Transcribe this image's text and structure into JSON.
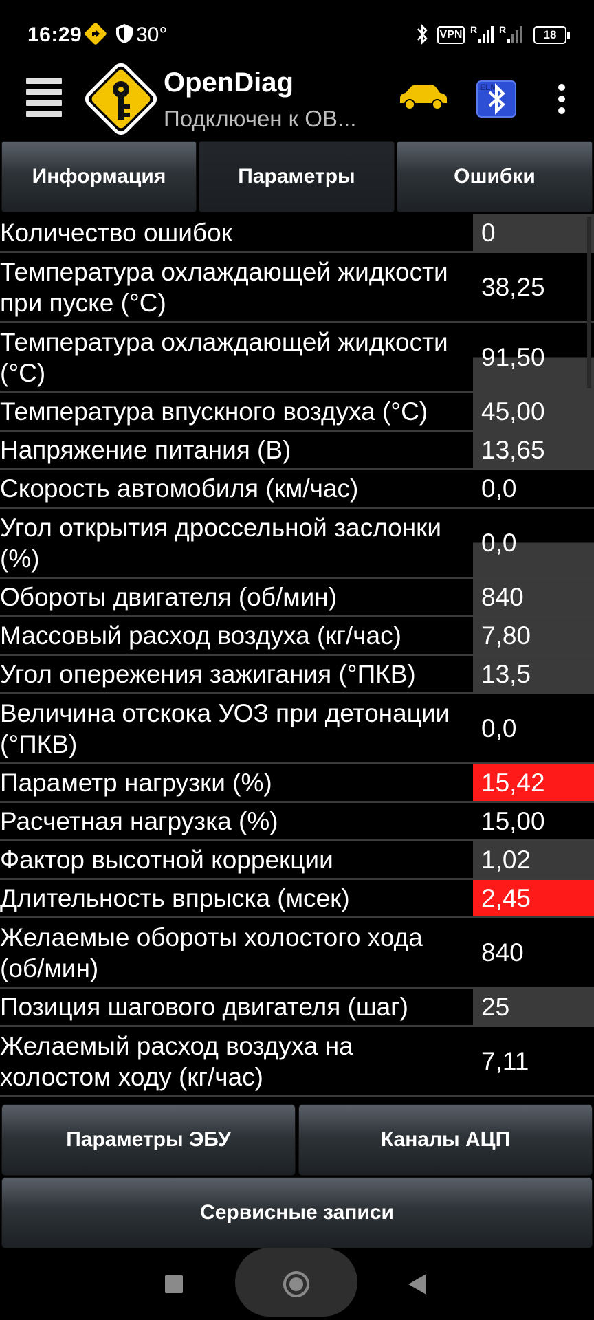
{
  "status_bar": {
    "time": "16:29",
    "temperature": "30°",
    "vpn_label": "VPN",
    "battery": "18"
  },
  "app": {
    "title": "OpenDiag",
    "subtitle": "Подключен к ОВ..."
  },
  "tabs": [
    {
      "label": "Информация",
      "active": false
    },
    {
      "label": "Параметры",
      "active": true
    },
    {
      "label": "Ошибки",
      "active": false
    }
  ],
  "parameters": [
    {
      "name": "Количество ошибок",
      "value": "0",
      "highlight": "grey"
    },
    {
      "name": "Температура охлаждающей жидкости при пуске (°C)",
      "value": "38,25",
      "highlight": "none"
    },
    {
      "name": "Температура охлаждающей жидкости (°C)",
      "value": "91,50",
      "highlight": "half"
    },
    {
      "name": "Температура впускного воздуха (°C)",
      "value": "45,00",
      "highlight": "grey"
    },
    {
      "name": "Напряжение питания (В)",
      "value": "13,65",
      "highlight": "grey"
    },
    {
      "name": "Скорость автомобиля (км/час)",
      "value": "0,0",
      "highlight": "none"
    },
    {
      "name": "Угол открытия дроссельной заслонки (%)",
      "value": "0,0",
      "highlight": "half"
    },
    {
      "name": "Обороты двигателя (об/мин)",
      "value": "840",
      "highlight": "grey"
    },
    {
      "name": "Массовый расход воздуха (кг/час)",
      "value": "7,80",
      "highlight": "grey"
    },
    {
      "name": "Угол опережения зажигания (°ПКВ)",
      "value": "13,5",
      "highlight": "grey"
    },
    {
      "name": "Величина отскока УОЗ при детонации (°ПКВ)",
      "value": "0,0",
      "highlight": "none"
    },
    {
      "name": "Параметр нагрузки (%)",
      "value": "15,42",
      "highlight": "red"
    },
    {
      "name": "Расчетная нагрузка (%)",
      "value": "15,00",
      "highlight": "none"
    },
    {
      "name": "Фактор высотной коррекции",
      "value": "1,02",
      "highlight": "grey"
    },
    {
      "name": "Длительность впрыска (мсек)",
      "value": "2,45",
      "highlight": "red"
    },
    {
      "name": "Желаемые обороты холостого хода (об/мин)",
      "value": "840",
      "highlight": "none"
    },
    {
      "name": "Позиция шагового двигателя (шаг)",
      "value": "25",
      "highlight": "grey"
    },
    {
      "name": "Желаемый расход воздуха на холостом ходу (кг/час)",
      "value": "7,11",
      "highlight": "none"
    }
  ],
  "bottom_buttons": {
    "ecu_params": "Параметры ЭБУ",
    "adc_channels": "Каналы АЦП",
    "service_records": "Сервисные записи"
  },
  "colors": {
    "alert": "#ff1a1a",
    "value_cell": "#3a3a3a",
    "logo": "#f5c400"
  }
}
